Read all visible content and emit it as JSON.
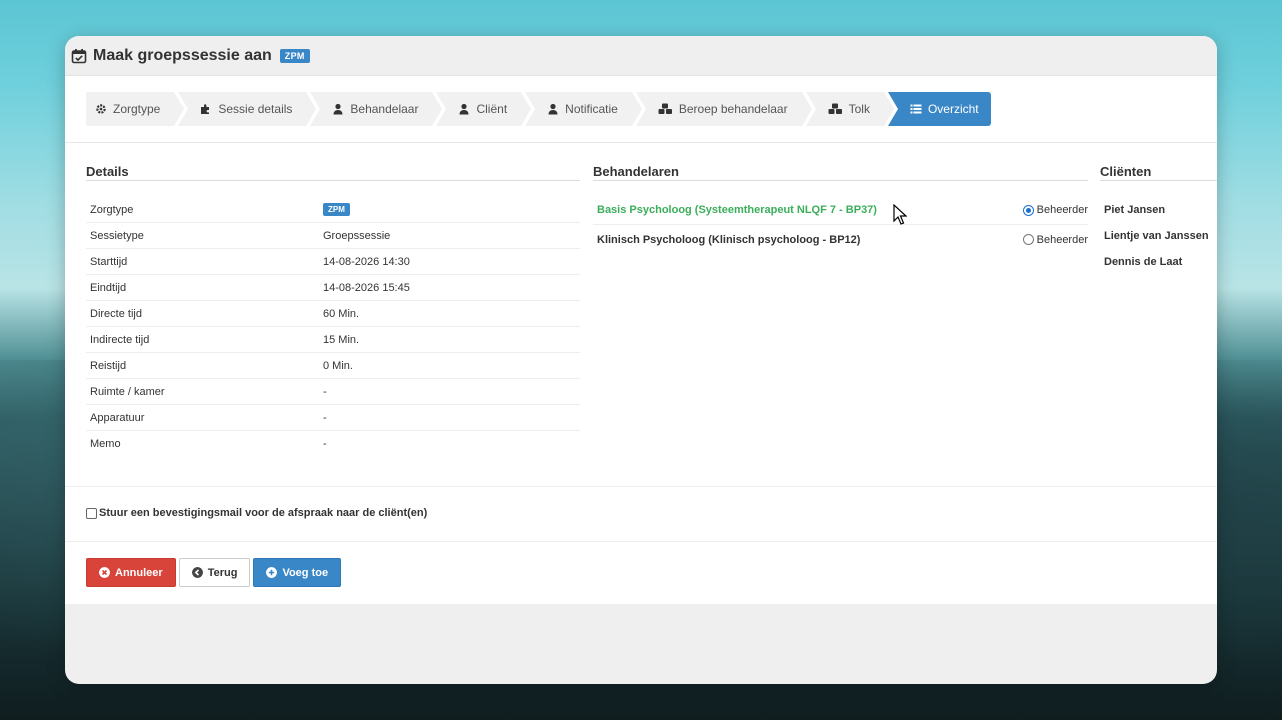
{
  "dialog": {
    "title": "Maak groepssessie aan",
    "badge": "ZPM"
  },
  "wizard": {
    "steps": [
      {
        "label": "Zorgtype",
        "icon": "gear-icon"
      },
      {
        "label": "Sessie details",
        "icon": "puzzle-icon"
      },
      {
        "label": "Behandelaar",
        "icon": "user-icon"
      },
      {
        "label": "Cliënt",
        "icon": "user-icon"
      },
      {
        "label": "Notificatie",
        "icon": "user-icon"
      },
      {
        "label": "Beroep behandelaar",
        "icon": "cubes-icon"
      },
      {
        "label": "Tolk",
        "icon": "cubes-icon"
      },
      {
        "label": "Overzicht",
        "icon": "list-icon",
        "active": true
      }
    ]
  },
  "details": {
    "title": "Details",
    "rows": [
      {
        "label": "Zorgtype",
        "value": "ZPM"
      },
      {
        "label": "Sessietype",
        "value": "Groepssessie"
      },
      {
        "label": "Starttijd",
        "value": "14-08-2026 14:30"
      },
      {
        "label": "Eindtijd",
        "value": "14-08-2026 15:45"
      },
      {
        "label": "Directe tijd",
        "value": "60 Min."
      },
      {
        "label": "Indirecte tijd",
        "value": "15 Min."
      },
      {
        "label": "Reistijd",
        "value": "0 Min."
      },
      {
        "label": "Ruimte / kamer",
        "value": "-"
      },
      {
        "label": "Apparatuur",
        "value": "-"
      },
      {
        "label": "Memo",
        "value": "-"
      }
    ]
  },
  "behandelaren": {
    "title": "Behandelaren",
    "rows": [
      {
        "name": "Basis Psycholoog (Systeemtherapeut NLQF 7 - BP37)",
        "radio_label": "Beheerder",
        "checked": true,
        "highlight_color": "#3bae5a"
      },
      {
        "name": "Klinisch Psycholoog (Klinisch psycholoog - BP12)",
        "radio_label": "Beheerder",
        "checked": false
      }
    ]
  },
  "clienten": {
    "title": "Cliënten",
    "names": [
      "Piet Jansen",
      "Lientje van Janssen",
      "Dennis de Laat"
    ]
  },
  "mail": {
    "label": "Stuur een bevestigingsmail voor de afspraak naar de cliënt(en)",
    "checked": false
  },
  "buttons": {
    "cancel": "Annuleer",
    "back": "Terug",
    "add": "Voeg toe"
  },
  "colors": {
    "primary": "#3a87c8",
    "danger": "#d9443a",
    "success": "#3bae5a"
  }
}
